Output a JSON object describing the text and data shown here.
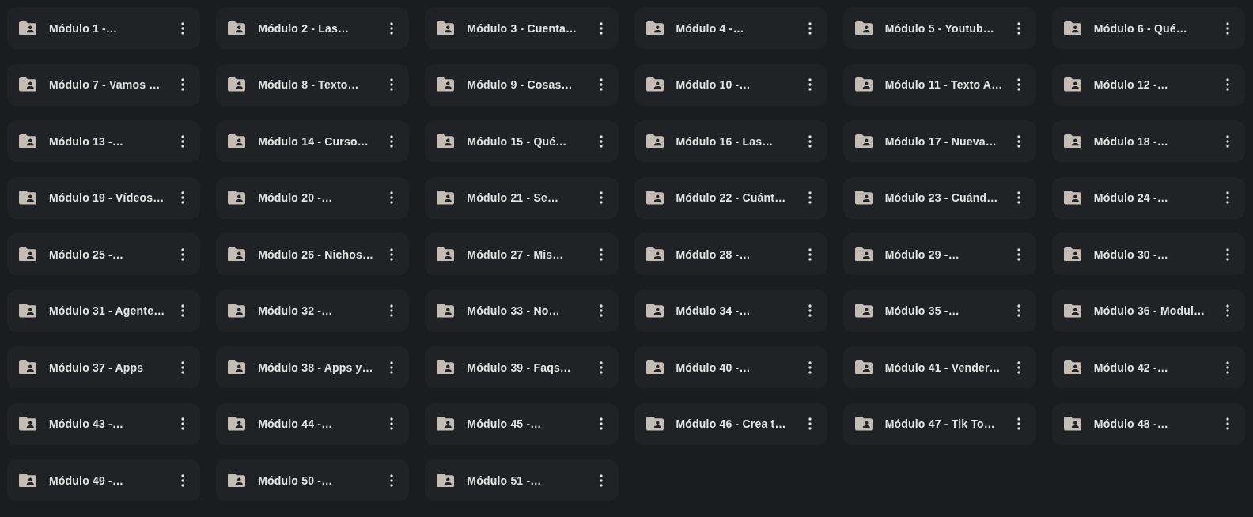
{
  "folders": [
    {
      "name": "Módulo 1 -…"
    },
    {
      "name": "Módulo 2 - Las…"
    },
    {
      "name": "Módulo 3 - Cuenta…"
    },
    {
      "name": "Módulo 4 -…"
    },
    {
      "name": "Módulo 5 - Youtub…"
    },
    {
      "name": "Módulo 6 - Qué…"
    },
    {
      "name": "Módulo 7 - Vamos …"
    },
    {
      "name": "Módulo 8 - Texto…"
    },
    {
      "name": "Módulo 9 - Cosas…"
    },
    {
      "name": "Módulo 10 -…"
    },
    {
      "name": "Módulo 11 - Texto A…"
    },
    {
      "name": "Módulo 12 -…"
    },
    {
      "name": "Módulo 13 -…"
    },
    {
      "name": "Módulo 14 - Curso…"
    },
    {
      "name": "Módulo 15 - Qué…"
    },
    {
      "name": "Módulo 16 - Las…"
    },
    {
      "name": "Módulo 17 - Nueva…"
    },
    {
      "name": "Módulo 18 -…"
    },
    {
      "name": "Módulo 19 - Vídeos…"
    },
    {
      "name": "Módulo 20 -…"
    },
    {
      "name": "Módulo 21 - Se…"
    },
    {
      "name": "Módulo 22 - Cuánt…"
    },
    {
      "name": "Módulo 23 - Cuánd…"
    },
    {
      "name": "Módulo 24 -…"
    },
    {
      "name": "Módulo 25 -…"
    },
    {
      "name": "Módulo 26 - Nichos…"
    },
    {
      "name": "Módulo 27 - Mis…"
    },
    {
      "name": "Módulo 28 -…"
    },
    {
      "name": "Módulo 29 -…"
    },
    {
      "name": "Módulo 30 -…"
    },
    {
      "name": "Módulo 31 - Agente…"
    },
    {
      "name": "Módulo 32 -…"
    },
    {
      "name": "Módulo 33 - No…"
    },
    {
      "name": "Módulo 34 -…"
    },
    {
      "name": "Módulo 35 -…"
    },
    {
      "name": "Módulo 36 - Modul…"
    },
    {
      "name": "Módulo 37 - Apps"
    },
    {
      "name": "Módulo 38 - Apps y…"
    },
    {
      "name": "Módulo 39 - Faqs…"
    },
    {
      "name": "Módulo 40 -…"
    },
    {
      "name": "Módulo 41 - Vender…"
    },
    {
      "name": "Módulo 42 -…"
    },
    {
      "name": "Módulo 43 -…"
    },
    {
      "name": "Módulo 44 -…"
    },
    {
      "name": "Módulo 45 -…"
    },
    {
      "name": "Módulo 46 - Crea t…"
    },
    {
      "name": "Módulo 47 - Tik To…"
    },
    {
      "name": "Módulo 48 -…"
    },
    {
      "name": "Módulo 49 -…"
    },
    {
      "name": "Módulo 50 -…"
    },
    {
      "name": "Módulo 51 -…"
    }
  ]
}
